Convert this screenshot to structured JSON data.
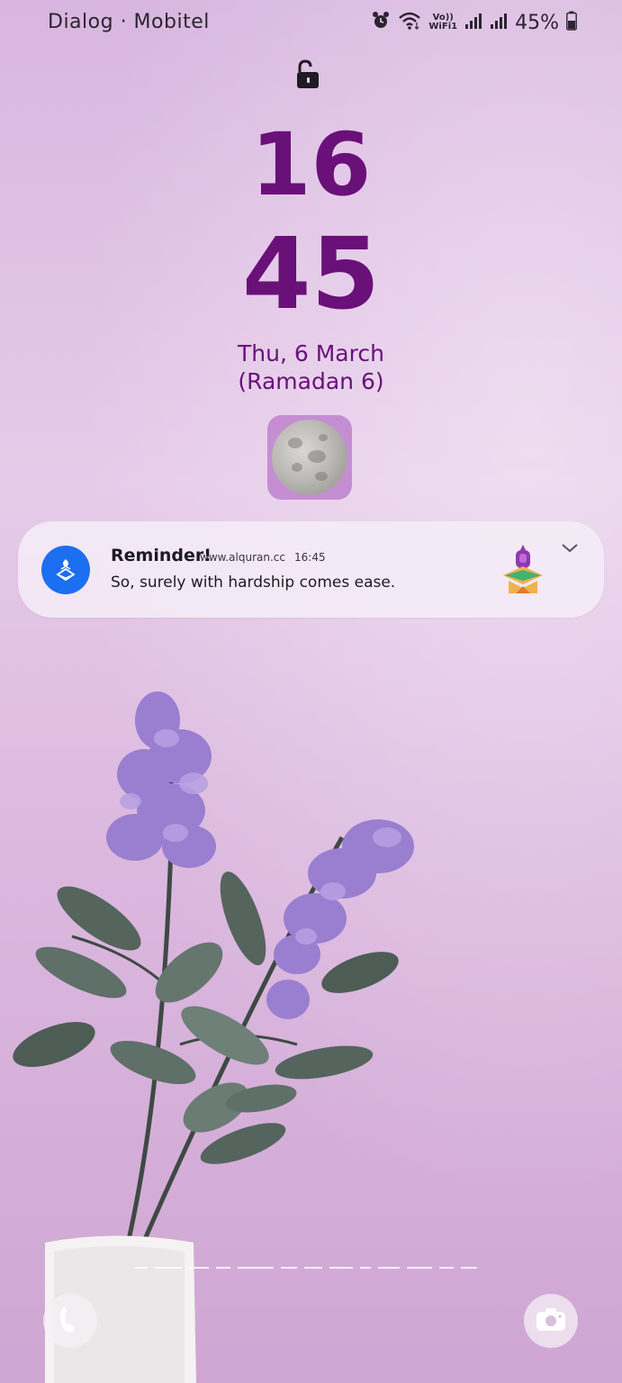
{
  "status_bar": {
    "carrier": "Dialog · Mobitel",
    "vowifi_line1": "Vo))",
    "vowifi_line2": "WiFi1",
    "battery_percent": "45%",
    "icons": [
      "alarm-icon",
      "wifi-icon",
      "vowifi-icon",
      "signal-icon",
      "signal-icon",
      "battery-icon"
    ]
  },
  "lock": {
    "icon": "unlock-icon"
  },
  "clock": {
    "hours": "16",
    "minutes": "45"
  },
  "date": {
    "main": "Thu, 6 March",
    "sub": "(Ramadan 6)"
  },
  "moon_widget": {
    "icon": "moon-phase-icon"
  },
  "notification": {
    "title": "Reminder!",
    "source": "www.alquran.cc",
    "time": "16:45",
    "body": "So, surely with hardship comes ease.",
    "app_icon": "quran-app-icon",
    "thumbnail": "quran-stand-icon",
    "expand_icon": "chevron-down-icon"
  },
  "shortcuts": {
    "left": "phone-icon",
    "right": "camera-icon"
  },
  "colors": {
    "clock": "#6a1079",
    "notification_icon_bg": "#1c6ff0",
    "wallpaper": "#e0c2e4"
  }
}
